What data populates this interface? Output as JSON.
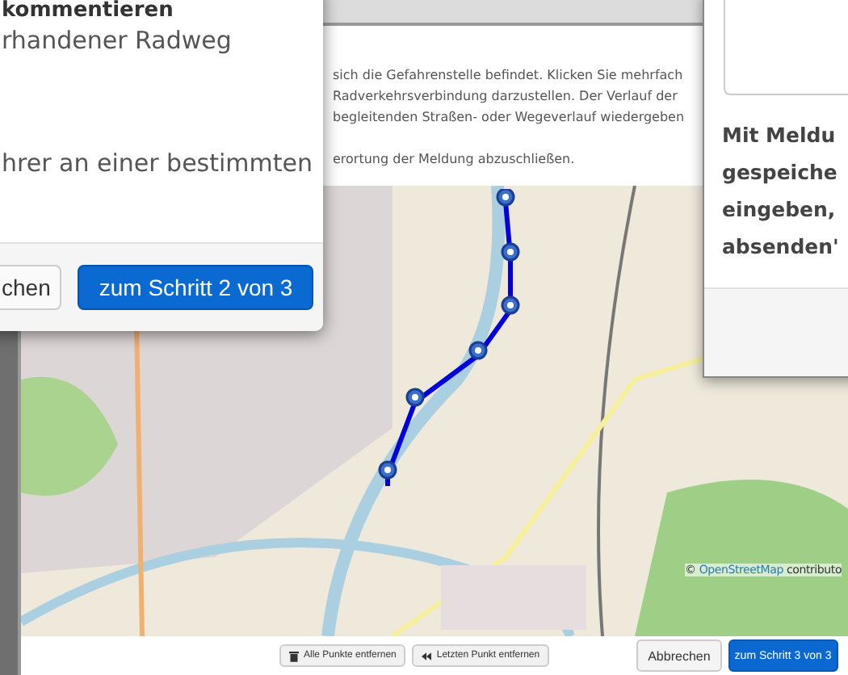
{
  "main_dialog": {
    "instructions": [
      "sich die Gefahrenstelle befindet. Klicken Sie mehrfach",
      "Radverkehrsverbindung darzustellen. Der Verlauf der",
      "begleitenden Straßen- oder Wegeverlauf wiedergeben",
      "erortung der Meldung abzuschließen."
    ],
    "map": {
      "kind": "picture",
      "attribution": {
        "prefix": "©",
        "link": "OpenStreetMap",
        "suffix": "contributo"
      }
    },
    "buttons": [
      {
        "label": "Alle Punkte entfernen",
        "kind": "trash"
      },
      {
        "label": "Letzten Punkt entfernen",
        "kind": "rewind"
      },
      {
        "label": "Abbrechen",
        "kind": "secondary"
      },
      {
        "label": "zum Schritt 3 von 3",
        "kind": "primary"
      }
    ]
  },
  "left_dialog": {
    "title": "kommentieren",
    "lines": [
      "rhandener Radweg",
      "hrer an einer bestimmten"
    ],
    "buttons": [
      {
        "label": "chen",
        "kind": "secondary"
      },
      {
        "label": "zum Schritt 2 von 3",
        "kind": "primary"
      }
    ]
  },
  "right_dialog": {
    "lines": [
      "Mit Meldu",
      "gespeiche",
      "eingeben,",
      "absenden'"
    ]
  }
}
